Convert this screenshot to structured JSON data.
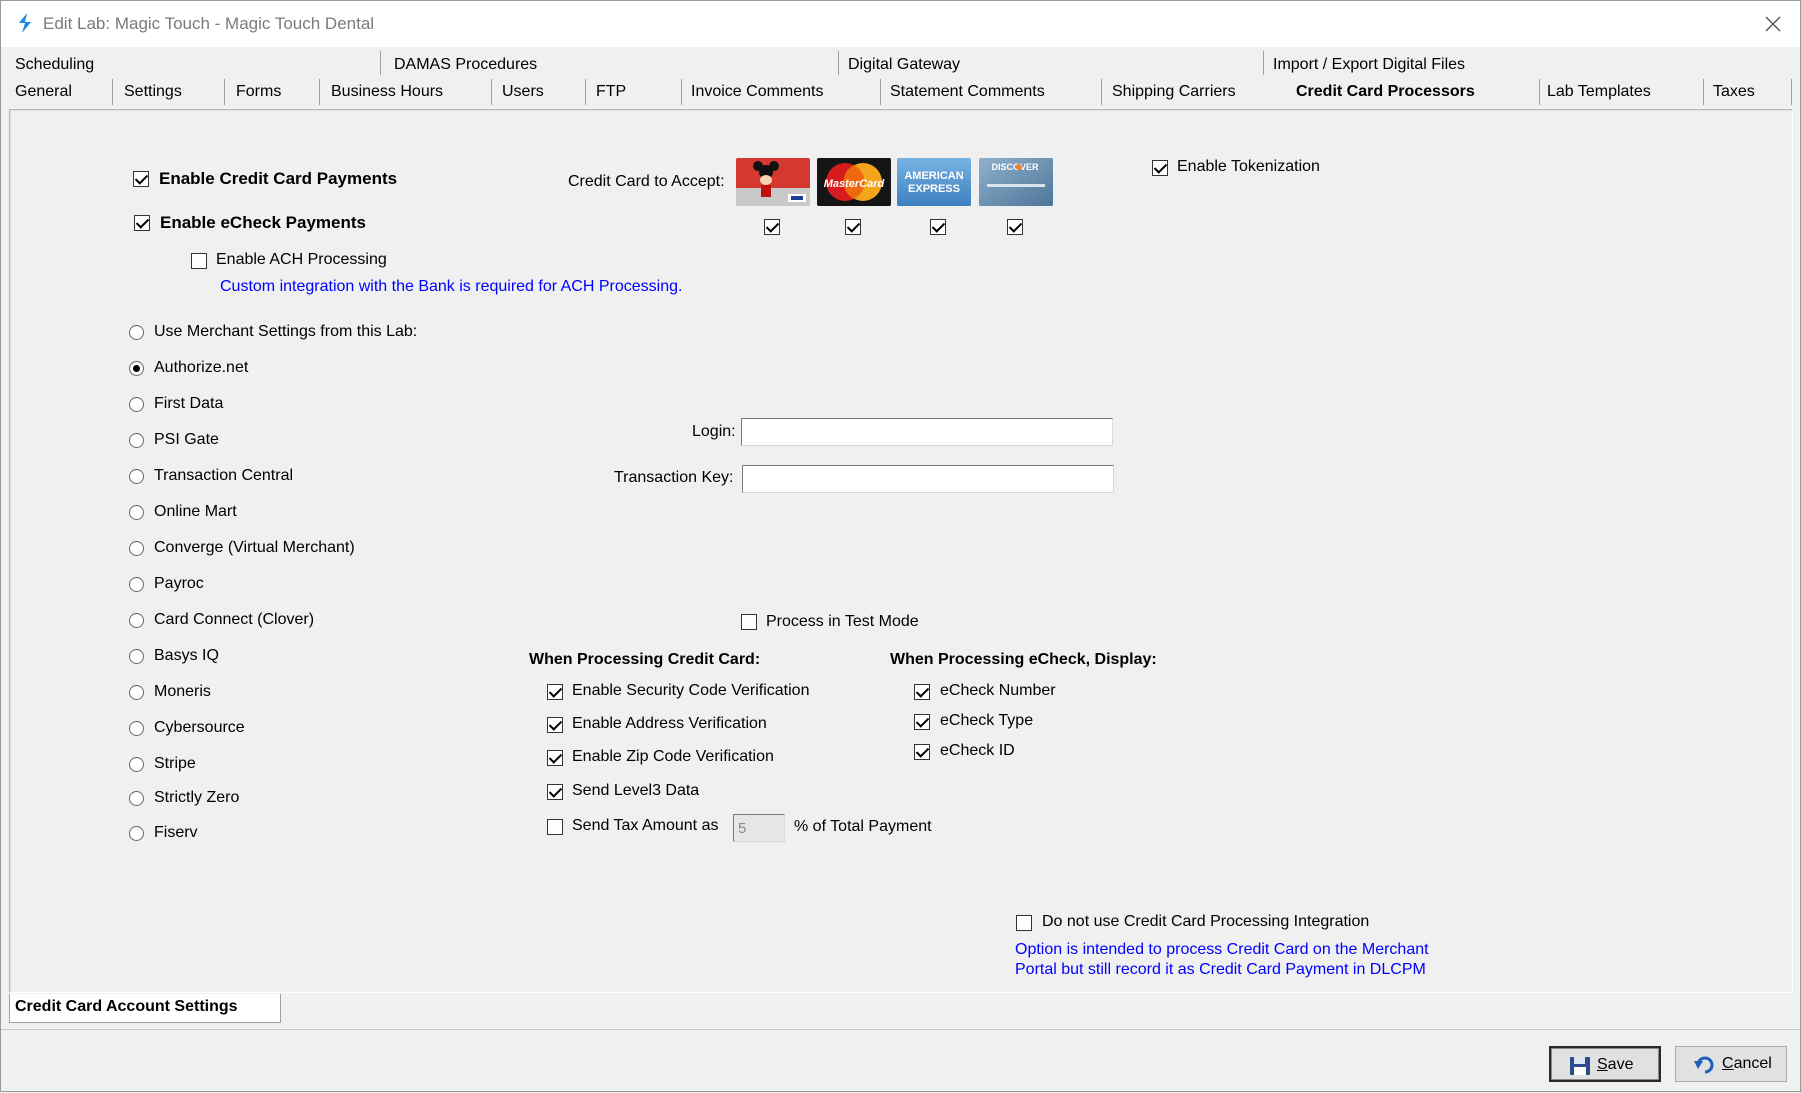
{
  "window": {
    "title": "Edit Lab: Magic Touch - Magic Touch Dental",
    "icon": "app-logo-icon",
    "close_icon": "close-icon"
  },
  "tabs": {
    "row1": [
      "Scheduling",
      "DAMAS Procedures",
      "Digital Gateway",
      "Import / Export Digital Files"
    ],
    "row2": [
      "General",
      "Settings",
      "Forms",
      "Business Hours",
      "Users",
      "FTP",
      "Invoice Comments",
      "Statement Comments",
      "Shipping Carriers",
      "Credit Card Processors",
      "Lab Templates",
      "Taxes"
    ],
    "active": "Credit Card Processors"
  },
  "payments": {
    "enable_cc": {
      "label": "Enable Credit Card Payments",
      "checked": true
    },
    "enable_echeck": {
      "label": "Enable eCheck Payments",
      "checked": true
    },
    "enable_ach": {
      "label": "Enable ACH Processing",
      "checked": false
    },
    "ach_note": "Custom integration with the Bank is required for ACH Processing."
  },
  "cards": {
    "label": "Credit Card to Accept:",
    "items": [
      {
        "name": "Visa",
        "checked": true,
        "icon": "visa-card-icon"
      },
      {
        "name": "MasterCard",
        "checked": true,
        "icon": "mastercard-card-icon"
      },
      {
        "name": "American Express",
        "checked": true,
        "icon": "amex-card-icon"
      },
      {
        "name": "Discover",
        "checked": true,
        "icon": "discover-card-icon"
      }
    ],
    "mastercard_text": "MasterCard",
    "amex_text_1": "AMERICAN",
    "amex_text_2": "EXPRESS",
    "discover_text": "DISCOVER"
  },
  "tokenization": {
    "label": "Enable Tokenization",
    "checked": true
  },
  "processors": {
    "selected": "Authorize.net",
    "options": [
      "Use Merchant Settings from this Lab:",
      "Authorize.net",
      "First Data",
      "PSI Gate",
      "Transaction Central",
      "Online Mart",
      "Converge (Virtual Merchant)",
      "Payroc",
      "Card Connect (Clover)",
      "Basys IQ",
      "Moneris",
      "Cybersource",
      "Stripe",
      "Strictly Zero",
      "Fiserv"
    ]
  },
  "credentials": {
    "login_label": "Login:",
    "login_value": "",
    "key_label": "Transaction Key:",
    "key_value": ""
  },
  "test_mode": {
    "label": "Process in Test Mode",
    "checked": false
  },
  "cc_processing": {
    "heading": "When Processing Credit Card:",
    "security_code": {
      "label": "Enable Security Code Verification",
      "checked": true
    },
    "address": {
      "label": "Enable Address Verification",
      "checked": true
    },
    "zip": {
      "label": "Enable Zip Code Verification",
      "checked": true
    },
    "level3": {
      "label": "Send Level3 Data",
      "checked": true
    },
    "tax": {
      "label": "Send Tax Amount as",
      "checked": false,
      "value": "5",
      "suffix": "% of Total Payment"
    }
  },
  "echeck_display": {
    "heading": "When Processing eCheck, Display:",
    "number": {
      "label": "eCheck Number",
      "checked": true
    },
    "type": {
      "label": "eCheck Type",
      "checked": true
    },
    "id": {
      "label": "eCheck ID",
      "checked": true
    }
  },
  "no_integration": {
    "label": "Do not use Credit Card Processing Integration",
    "checked": false,
    "note_line1": "Option is intended to process Credit Card on the Merchant",
    "note_line2": "Portal but still record it as Credit Card Payment in DLCPM"
  },
  "bottom_tab": "Credit Card Account Settings",
  "buttons": {
    "save": {
      "label_underline": "S",
      "label_rest": "ave",
      "icon": "floppy-disk-icon"
    },
    "cancel": {
      "label_underline": "C",
      "label_rest": "ancel",
      "icon": "undo-arrow-icon"
    }
  },
  "colors": {
    "link_blue": "#0000ff",
    "accent": "#2a7fd4"
  }
}
